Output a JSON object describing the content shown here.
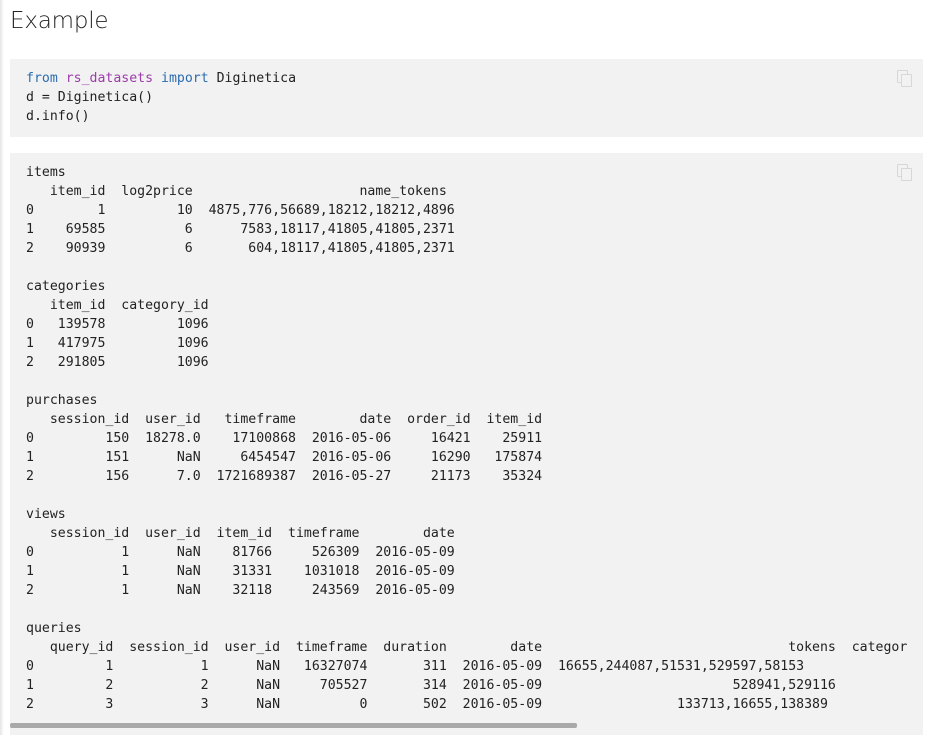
{
  "heading": "Example",
  "code": {
    "line1": {
      "kw_from": "from",
      "module": "rs_datasets",
      "kw_import": "import",
      "name": "Diginetica"
    },
    "line2": "d = Diginetica()",
    "line3": "d.info()"
  },
  "output": {
    "sections": [
      {
        "title": "items",
        "lines": [
          "   item_id  log2price                     name_tokens",
          "0        1         10  4875,776,56689,18212,18212,4896",
          "1    69585          6      7583,18117,41805,41805,2371",
          "2    90939          6       604,18117,41805,41805,2371"
        ]
      },
      {
        "title": "categories",
        "lines": [
          "   item_id  category_id",
          "0   139578         1096",
          "1   417975         1096",
          "2   291805         1096"
        ]
      },
      {
        "title": "purchases",
        "lines": [
          "   session_id  user_id   timeframe        date  order_id  item_id",
          "0         150  18278.0    17100868  2016-05-06     16421    25911",
          "1         151      NaN     6454547  2016-05-06     16290   175874",
          "2         156      7.0  1721689387  2016-05-27     21173    35324"
        ]
      },
      {
        "title": "views",
        "lines": [
          "   session_id  user_id  item_id  timeframe        date",
          "0           1      NaN    81766     526309  2016-05-09",
          "1           1      NaN    31331    1031018  2016-05-09",
          "2           1      NaN    32118     243569  2016-05-09"
        ]
      },
      {
        "title": "queries",
        "lines": [
          "   query_id  session_id  user_id  timeframe  duration        date                               tokens  categor",
          "0         1           1      NaN   16327074       311  2016-05-09  16655,244087,51531,529597,58153",
          "1         2           2      NaN     705527       314  2016-05-09                        528941,529116",
          "2         3           3      NaN          0       502  2016-05-09                 133713,16655,138389"
        ]
      }
    ]
  },
  "icons": {
    "copy_code": "copy-icon",
    "copy_output": "copy-icon"
  }
}
